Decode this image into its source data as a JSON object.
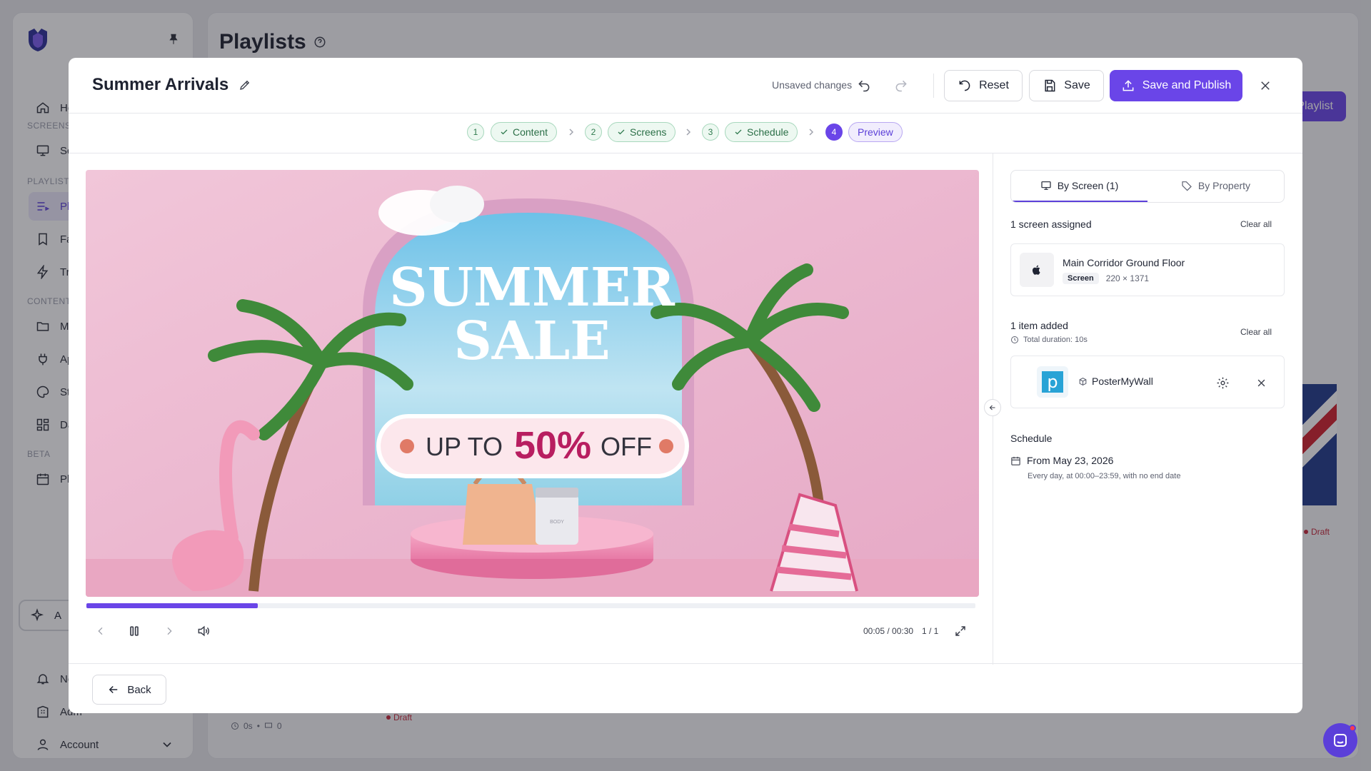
{
  "background": {
    "page_title": "Playlists",
    "sidebar": {
      "sections": [
        "SCREENS",
        "PLAYLISTS",
        "CONTENT",
        "BETA"
      ],
      "items": [
        {
          "label": "Hon",
          "icon": "home-icon"
        },
        {
          "label": "Scre",
          "icon": "monitor-icon"
        },
        {
          "label": "Play",
          "icon": "playlist-icon"
        },
        {
          "label": "Fall",
          "icon": "bookmark-icon"
        },
        {
          "label": "Trig",
          "icon": "bolt-icon"
        },
        {
          "label": "Med",
          "icon": "folder-icon"
        },
        {
          "label": "App",
          "icon": "plug-icon"
        },
        {
          "label": "Stu",
          "icon": "palette-icon"
        },
        {
          "label": "Das",
          "icon": "dashboard-icon"
        },
        {
          "label": "Plar",
          "icon": "calendar-icon"
        },
        {
          "label": "Noti",
          "icon": "bell-icon"
        },
        {
          "label": "Adm",
          "icon": "building-icon"
        },
        {
          "label": "Account",
          "icon": "user-icon"
        }
      ],
      "ai_label": "A"
    },
    "new_button_label": "Playlist",
    "draft_badges": [
      "Draft",
      "Draft"
    ],
    "card_meta": {
      "duration": "0s",
      "count": "0"
    }
  },
  "modal": {
    "title": "Summer Arrivals",
    "unsaved_text": "Unsaved changes",
    "reset_label": "Reset",
    "save_label": "Save",
    "publish_label": "Save and Publish",
    "steps": [
      {
        "num": "1",
        "label": "Content",
        "state": "done"
      },
      {
        "num": "2",
        "label": "Screens",
        "state": "done"
      },
      {
        "num": "3",
        "label": "Schedule",
        "state": "done"
      },
      {
        "num": "4",
        "label": "Preview",
        "state": "current"
      }
    ],
    "preview": {
      "headline_line1": "SUMMER",
      "headline_line2": "SALE",
      "offer_prefix": "UP TO",
      "offer_value": "50%",
      "offer_suffix": "OFF",
      "bottle_label": "BODY",
      "progress_fraction": 0.1928,
      "time": "00:05 / 00:30",
      "page": "1 / 1"
    },
    "tabs": [
      {
        "label": "By Screen (1)",
        "icon": "monitor-icon",
        "active": true
      },
      {
        "label": "By Property",
        "icon": "tag-icon",
        "active": false
      }
    ],
    "screens": {
      "count_text": "1 screen assigned",
      "clear_label": "Clear all",
      "item": {
        "name": "Main Corridor Ground Floor",
        "type": "Screen",
        "resolution": "220 × 1371"
      }
    },
    "items": {
      "count_text": "1 item added",
      "duration_text": "Total duration: 10s",
      "clear_label": "Clear all",
      "item": {
        "name": "PosterMyWall",
        "logo_letter": "p"
      }
    },
    "schedule": {
      "heading": "Schedule",
      "from_text": "From May 23, 2026",
      "detail_text": "Every day, at 00:00–23:59, with no end date"
    },
    "back_label": "Back"
  },
  "colors": {
    "accent": "#6a45e8",
    "success": "#2f7a4e",
    "draft": "#c4263a"
  }
}
